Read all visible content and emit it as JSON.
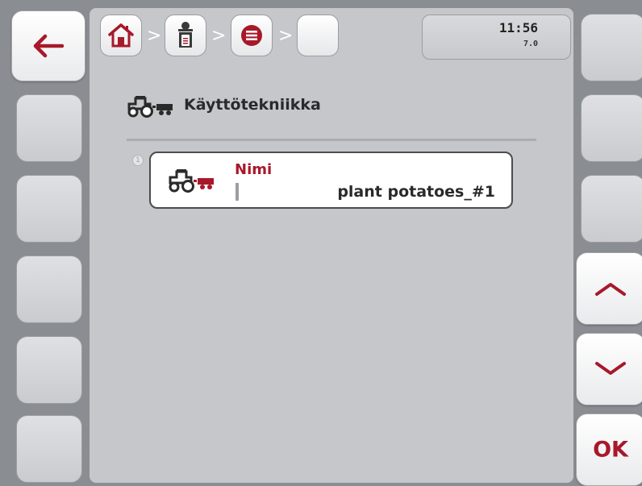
{
  "header": {
    "time": "11:56",
    "version": "7.0",
    "separator": ">"
  },
  "page": {
    "title": "Käyttötekniikka"
  },
  "list": {
    "items": [
      {
        "index": "1",
        "label": "Nimi",
        "value": "plant potatoes_#1"
      }
    ]
  },
  "softkeys": {
    "ok_label": "OK"
  },
  "colors": {
    "accent": "#a8182a",
    "panel": "#c5c7ca",
    "frame": "#8a8d92"
  },
  "icons": {
    "back": "arrow-left-icon",
    "home": "home-icon",
    "operator": "operator-icon",
    "menu": "menu-icon",
    "machine": "tractor-icon",
    "up": "chevron-up-icon",
    "down": "chevron-down-icon"
  }
}
